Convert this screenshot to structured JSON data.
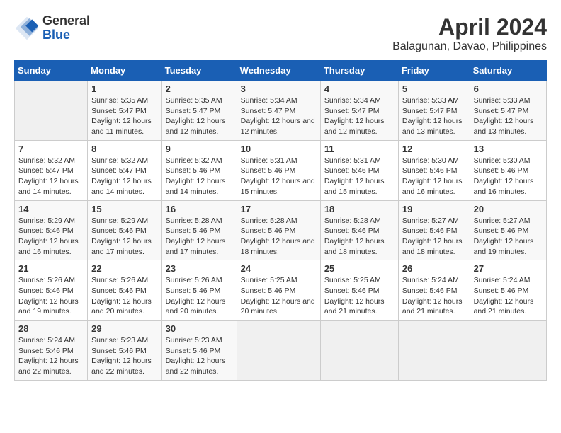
{
  "header": {
    "logo_line1": "General",
    "logo_line2": "Blue",
    "title": "April 2024",
    "subtitle": "Balagunan, Davao, Philippines"
  },
  "calendar": {
    "days_of_week": [
      "Sunday",
      "Monday",
      "Tuesday",
      "Wednesday",
      "Thursday",
      "Friday",
      "Saturday"
    ],
    "weeks": [
      [
        {
          "day": "",
          "sunrise": "",
          "sunset": "",
          "daylight": ""
        },
        {
          "day": "1",
          "sunrise": "Sunrise: 5:35 AM",
          "sunset": "Sunset: 5:47 PM",
          "daylight": "Daylight: 12 hours and 11 minutes."
        },
        {
          "day": "2",
          "sunrise": "Sunrise: 5:35 AM",
          "sunset": "Sunset: 5:47 PM",
          "daylight": "Daylight: 12 hours and 12 minutes."
        },
        {
          "day": "3",
          "sunrise": "Sunrise: 5:34 AM",
          "sunset": "Sunset: 5:47 PM",
          "daylight": "Daylight: 12 hours and 12 minutes."
        },
        {
          "day": "4",
          "sunrise": "Sunrise: 5:34 AM",
          "sunset": "Sunset: 5:47 PM",
          "daylight": "Daylight: 12 hours and 12 minutes."
        },
        {
          "day": "5",
          "sunrise": "Sunrise: 5:33 AM",
          "sunset": "Sunset: 5:47 PM",
          "daylight": "Daylight: 12 hours and 13 minutes."
        },
        {
          "day": "6",
          "sunrise": "Sunrise: 5:33 AM",
          "sunset": "Sunset: 5:47 PM",
          "daylight": "Daylight: 12 hours and 13 minutes."
        }
      ],
      [
        {
          "day": "7",
          "sunrise": "Sunrise: 5:32 AM",
          "sunset": "Sunset: 5:47 PM",
          "daylight": "Daylight: 12 hours and 14 minutes."
        },
        {
          "day": "8",
          "sunrise": "Sunrise: 5:32 AM",
          "sunset": "Sunset: 5:47 PM",
          "daylight": "Daylight: 12 hours and 14 minutes."
        },
        {
          "day": "9",
          "sunrise": "Sunrise: 5:32 AM",
          "sunset": "Sunset: 5:46 PM",
          "daylight": "Daylight: 12 hours and 14 minutes."
        },
        {
          "day": "10",
          "sunrise": "Sunrise: 5:31 AM",
          "sunset": "Sunset: 5:46 PM",
          "daylight": "Daylight: 12 hours and 15 minutes."
        },
        {
          "day": "11",
          "sunrise": "Sunrise: 5:31 AM",
          "sunset": "Sunset: 5:46 PM",
          "daylight": "Daylight: 12 hours and 15 minutes."
        },
        {
          "day": "12",
          "sunrise": "Sunrise: 5:30 AM",
          "sunset": "Sunset: 5:46 PM",
          "daylight": "Daylight: 12 hours and 16 minutes."
        },
        {
          "day": "13",
          "sunrise": "Sunrise: 5:30 AM",
          "sunset": "Sunset: 5:46 PM",
          "daylight": "Daylight: 12 hours and 16 minutes."
        }
      ],
      [
        {
          "day": "14",
          "sunrise": "Sunrise: 5:29 AM",
          "sunset": "Sunset: 5:46 PM",
          "daylight": "Daylight: 12 hours and 16 minutes."
        },
        {
          "day": "15",
          "sunrise": "Sunrise: 5:29 AM",
          "sunset": "Sunset: 5:46 PM",
          "daylight": "Daylight: 12 hours and 17 minutes."
        },
        {
          "day": "16",
          "sunrise": "Sunrise: 5:28 AM",
          "sunset": "Sunset: 5:46 PM",
          "daylight": "Daylight: 12 hours and 17 minutes."
        },
        {
          "day": "17",
          "sunrise": "Sunrise: 5:28 AM",
          "sunset": "Sunset: 5:46 PM",
          "daylight": "Daylight: 12 hours and 18 minutes."
        },
        {
          "day": "18",
          "sunrise": "Sunrise: 5:28 AM",
          "sunset": "Sunset: 5:46 PM",
          "daylight": "Daylight: 12 hours and 18 minutes."
        },
        {
          "day": "19",
          "sunrise": "Sunrise: 5:27 AM",
          "sunset": "Sunset: 5:46 PM",
          "daylight": "Daylight: 12 hours and 18 minutes."
        },
        {
          "day": "20",
          "sunrise": "Sunrise: 5:27 AM",
          "sunset": "Sunset: 5:46 PM",
          "daylight": "Daylight: 12 hours and 19 minutes."
        }
      ],
      [
        {
          "day": "21",
          "sunrise": "Sunrise: 5:26 AM",
          "sunset": "Sunset: 5:46 PM",
          "daylight": "Daylight: 12 hours and 19 minutes."
        },
        {
          "day": "22",
          "sunrise": "Sunrise: 5:26 AM",
          "sunset": "Sunset: 5:46 PM",
          "daylight": "Daylight: 12 hours and 20 minutes."
        },
        {
          "day": "23",
          "sunrise": "Sunrise: 5:26 AM",
          "sunset": "Sunset: 5:46 PM",
          "daylight": "Daylight: 12 hours and 20 minutes."
        },
        {
          "day": "24",
          "sunrise": "Sunrise: 5:25 AM",
          "sunset": "Sunset: 5:46 PM",
          "daylight": "Daylight: 12 hours and 20 minutes."
        },
        {
          "day": "25",
          "sunrise": "Sunrise: 5:25 AM",
          "sunset": "Sunset: 5:46 PM",
          "daylight": "Daylight: 12 hours and 21 minutes."
        },
        {
          "day": "26",
          "sunrise": "Sunrise: 5:24 AM",
          "sunset": "Sunset: 5:46 PM",
          "daylight": "Daylight: 12 hours and 21 minutes."
        },
        {
          "day": "27",
          "sunrise": "Sunrise: 5:24 AM",
          "sunset": "Sunset: 5:46 PM",
          "daylight": "Daylight: 12 hours and 21 minutes."
        }
      ],
      [
        {
          "day": "28",
          "sunrise": "Sunrise: 5:24 AM",
          "sunset": "Sunset: 5:46 PM",
          "daylight": "Daylight: 12 hours and 22 minutes."
        },
        {
          "day": "29",
          "sunrise": "Sunrise: 5:23 AM",
          "sunset": "Sunset: 5:46 PM",
          "daylight": "Daylight: 12 hours and 22 minutes."
        },
        {
          "day": "30",
          "sunrise": "Sunrise: 5:23 AM",
          "sunset": "Sunset: 5:46 PM",
          "daylight": "Daylight: 12 hours and 22 minutes."
        },
        {
          "day": "",
          "sunrise": "",
          "sunset": "",
          "daylight": ""
        },
        {
          "day": "",
          "sunrise": "",
          "sunset": "",
          "daylight": ""
        },
        {
          "day": "",
          "sunrise": "",
          "sunset": "",
          "daylight": ""
        },
        {
          "day": "",
          "sunrise": "",
          "sunset": "",
          "daylight": ""
        }
      ]
    ]
  }
}
